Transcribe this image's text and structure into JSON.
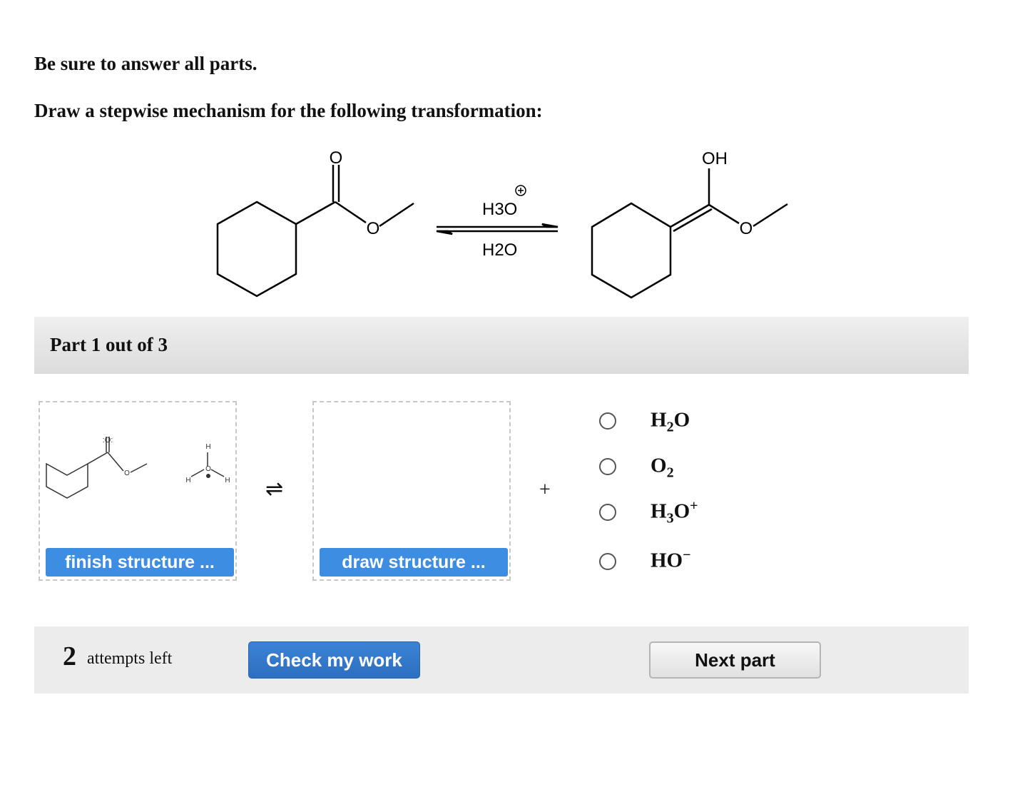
{
  "instructions": {
    "line1": "Be sure to answer all parts.",
    "line2": "Draw a stepwise mechanism for the following transformation:"
  },
  "scheme": {
    "reactant_carbonyl_o": "O",
    "reactant_ester_o": "O",
    "reagent_top": "H3O",
    "reagent_bottom": "H2O",
    "product_oh": "OH",
    "product_ester_o": "O"
  },
  "part": {
    "title": "Part 1 out of 3"
  },
  "box1": {
    "lone_pairs_o": ":O:",
    "h_top": "H",
    "h_left": "H",
    "h_right": "H",
    "o_center": "O",
    "button_label": "finish structure ..."
  },
  "equilibrium_symbol": "⇌",
  "box2": {
    "button_label": "draw structure ..."
  },
  "plus_sign": "+",
  "options": [
    {
      "main": "H",
      "sub": "2",
      "tail": "O",
      "sup": ""
    },
    {
      "main": "O",
      "sub": "2",
      "tail": "",
      "sup": ""
    },
    {
      "main": "H",
      "sub": "3",
      "tail": "O",
      "sup": "+"
    },
    {
      "main": "HO",
      "sub": "",
      "tail": "",
      "sup": "−"
    }
  ],
  "footer": {
    "attempts_count": "2",
    "attempts_text": "attempts left",
    "check_label": "Check my work",
    "next_label": "Next part"
  }
}
